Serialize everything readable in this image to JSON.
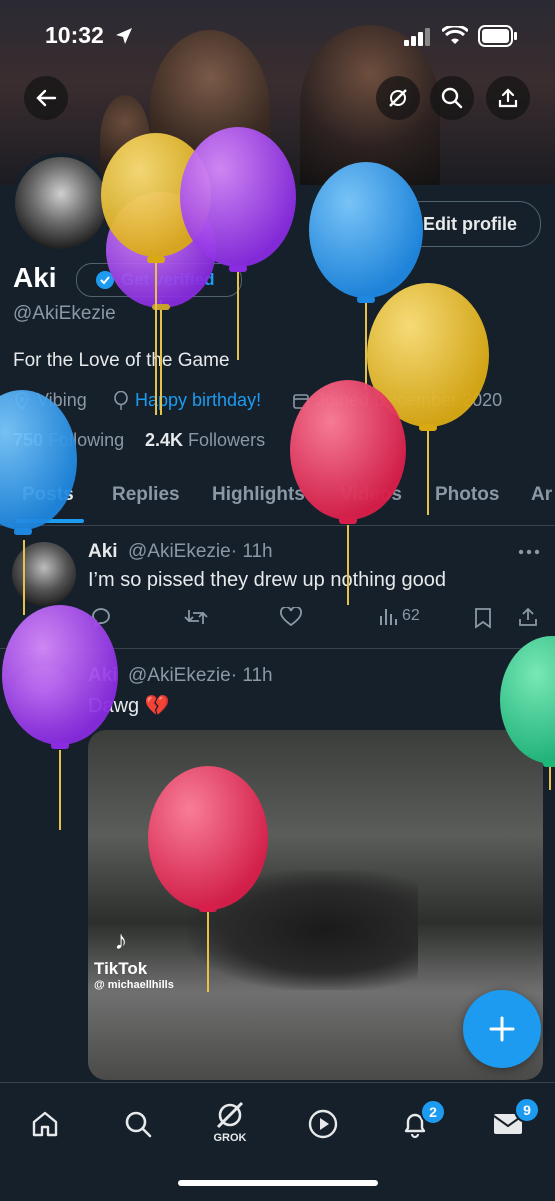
{
  "status_bar": {
    "time": "10:32"
  },
  "header": {
    "back_icon": "arrow-left-icon",
    "grok_icon": "grok-icon",
    "search_icon": "search-icon",
    "share_icon": "share-icon"
  },
  "profile": {
    "edit_profile_label": "Edit profile",
    "display_name": "Aki",
    "get_verified_label": "Get verified",
    "handle": "@AkiEkezie",
    "bio": "For the Love of the Game",
    "location": "Vibing",
    "birthday": "Happy birthday!",
    "joined": "Joined December 2020",
    "following_count": "750",
    "following_label": "Following",
    "followers_count": "2.4K",
    "followers_label": "Followers"
  },
  "tabs": [
    "Posts",
    "Replies",
    "Highlights",
    "Videos",
    "Photos",
    "Ar"
  ],
  "tweets": [
    {
      "name": "Aki",
      "handle": "@AkiEkezie",
      "time": "· 11h",
      "text": "I’m so pissed they drew up nothing good",
      "views": "62"
    },
    {
      "name": "Aki",
      "handle": "@AkiEkezie",
      "time": "· 11h",
      "text": "Dawg 💔",
      "media_watermark": "TikTok",
      "media_user": "@ michaellhills"
    }
  ],
  "bottom_nav": {
    "grok_label": "GROK",
    "notifications_badge": "2",
    "messages_badge": "9"
  },
  "colors": {
    "background": "#15202b",
    "accent": "#1d9bf0",
    "muted": "#8b98a5"
  }
}
